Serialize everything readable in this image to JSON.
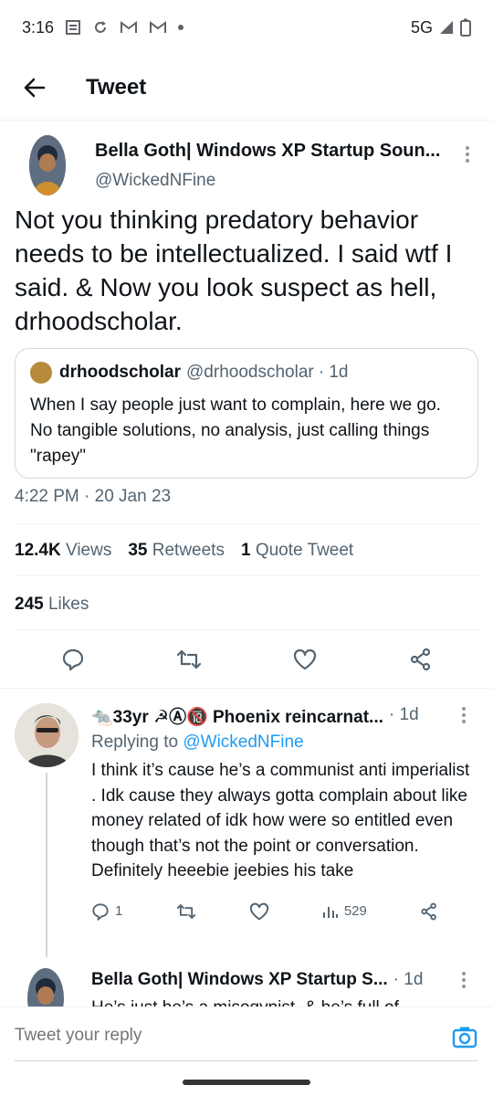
{
  "status_bar": {
    "time": "3:16",
    "network": "5G",
    "icons": [
      "news-icon",
      "refresh-icon",
      "gmail-icon",
      "gmail-icon",
      "dot-icon",
      "signal-icon",
      "battery-icon"
    ]
  },
  "header": {
    "title": "Tweet"
  },
  "tweet": {
    "author_name": "Bella Goth| Windows XP Startup Soun...",
    "author_handle": "@WickedNFine",
    "text": "Not you thinking predatory behavior needs to be intellectualized. I said wtf I said. & Now you look suspect as hell, drhoodscholar.",
    "quote": {
      "name": "drhoodscholar",
      "handle": "@drhoodscholar",
      "time": "· 1d",
      "text": "When I say people just want to complain, here we go. No tangible solutions, no analysis, just calling things \"rapey\""
    },
    "timestamp": "4:22 PM · 20 Jan 23",
    "stats": {
      "views_count": "12.4K",
      "views_label": "Views",
      "retweets_count": "35",
      "retweets_label": "Retweets",
      "quotes_count": "1",
      "quotes_label": "Quote Tweet",
      "likes_count": "245",
      "likes_label": "Likes"
    }
  },
  "replies": [
    {
      "name": "🐀33yr ☭Ⓐ🔞 Phoenix reincarnat...",
      "time": "· 1d",
      "replying_prefix": "Replying to",
      "replying_to": "@WickedNFine",
      "text": "I think it’s cause he’s a communist anti imperialist . Idk cause they always gotta complain about like money related of idk how were so entitled even though that’s not the point or conversation. Definitely heeebie jeebies his take",
      "reply_count": "1",
      "views": "529"
    },
    {
      "name": "Bella Goth| Windows XP Startup S...",
      "time": "· 1d",
      "text": "He’s just he’s a misogynist, & he’s full of"
    }
  ],
  "compose": {
    "placeholder": "Tweet your reply"
  },
  "colors": {
    "accent": "#1d9bf0",
    "text": "#0f1419",
    "muted": "#536471",
    "border": "#cfd9de"
  }
}
